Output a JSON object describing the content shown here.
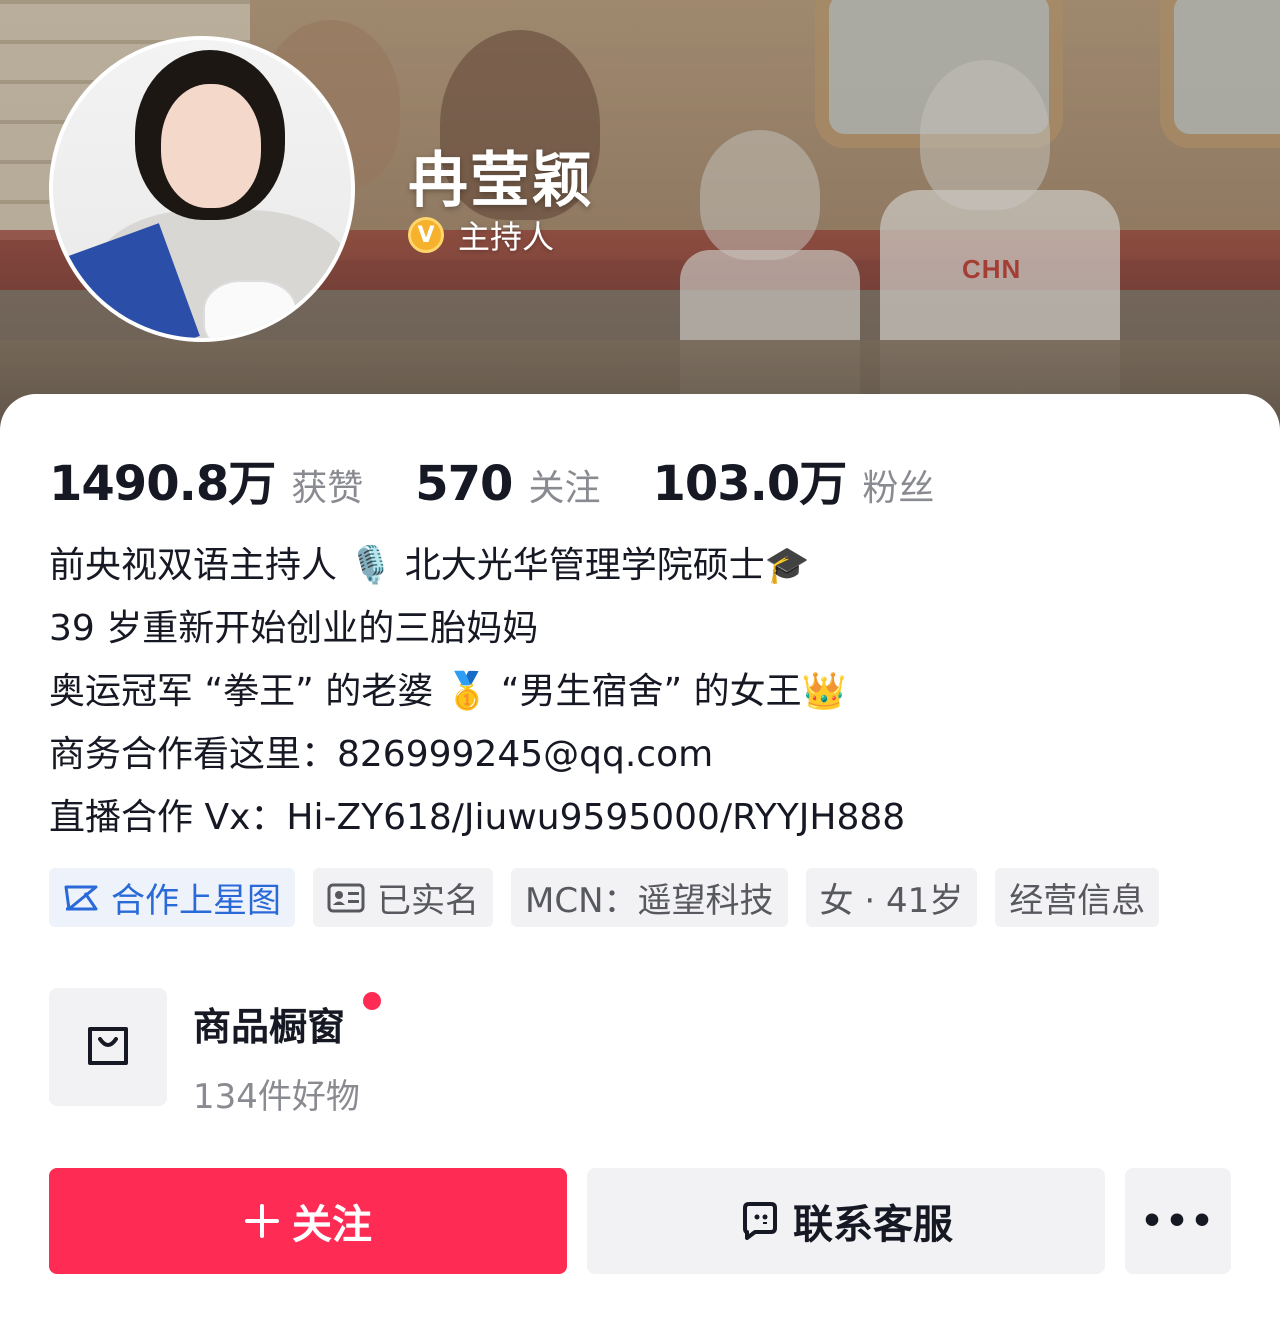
{
  "profile": {
    "name": "冉莹颖",
    "verified_badge": "V",
    "verified_title": "主持人"
  },
  "stats": [
    {
      "value": "1490.8万",
      "label": "获赞"
    },
    {
      "value": "570",
      "label": "关注"
    },
    {
      "value": "103.0万",
      "label": "粉丝"
    }
  ],
  "bio": [
    "前央视双语主持人 🎙️ 北大光华管理学院硕士🎓",
    "39 岁重新开始创业的三胎妈妈",
    "奥运冠军 “拳王” 的老婆 🥇 “男生宿舍” 的女王👑",
    " 商务合作看这里：826999245@qq.com",
    "直播合作 Vx：Hi-ZY618/Jiuwu9595000/RYYJH888"
  ],
  "tags": {
    "star_map": "合作上星图",
    "real_name": "已实名",
    "mcn": "MCN：遥望科技",
    "gender_age": "女 · 41岁",
    "business_info": "经营信息"
  },
  "shop": {
    "title": "商品橱窗",
    "subtitle": "134件好物"
  },
  "actions": {
    "follow": "关注",
    "contact": "联系客服",
    "more": "•••"
  },
  "cover_text": "CHN",
  "colors": {
    "accent": "#fe2c55",
    "link_blue": "#2a6ad8",
    "verify_gold": "#f6b12d"
  }
}
